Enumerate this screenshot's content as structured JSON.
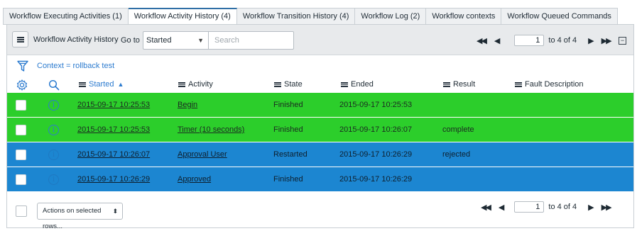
{
  "tabs": [
    {
      "label": "Workflow Executing Activities (1)",
      "active": false
    },
    {
      "label": "Workflow Activity History (4)",
      "active": true
    },
    {
      "label": "Workflow Transition History (4)",
      "active": false
    },
    {
      "label": "Workflow Log (2)",
      "active": false
    },
    {
      "label": "Workflow contexts",
      "active": false
    },
    {
      "label": "Workflow Queued Commands",
      "active": false
    }
  ],
  "toolbar": {
    "list_title": "Workflow Activity History",
    "goto_label": "Go to",
    "goto_value": "Started",
    "search_placeholder": "Search",
    "menu_icon": "hamburger-icon"
  },
  "pagination": {
    "current_page": "1",
    "range_text": "to 4 of 4"
  },
  "filter": {
    "breadcrumb": "Context = rollback test",
    "icon": "funnel-icon"
  },
  "columns": [
    {
      "label": "Started",
      "sorted": "ascending"
    },
    {
      "label": "Activity"
    },
    {
      "label": "State"
    },
    {
      "label": "Ended"
    },
    {
      "label": "Result"
    },
    {
      "label": "Fault Description"
    }
  ],
  "rows": [
    {
      "started": "2015-09-17 10:25:53",
      "activity": "Begin",
      "state": "Finished",
      "ended": "2015-09-17 10:25:53",
      "result": "",
      "fault": "",
      "color": "#2cce2b"
    },
    {
      "started": "2015-09-17 10:25:53",
      "activity": "Timer (10 seconds)",
      "state": "Finished",
      "ended": "2015-09-17 10:26:07",
      "result": "complete",
      "fault": "",
      "color": "#2cce2b"
    },
    {
      "started": "2015-09-17 10:26:07",
      "activity": "Approval User",
      "state": "Restarted",
      "ended": "2015-09-17 10:26:29",
      "result": "rejected",
      "fault": "",
      "color": "#1c86d1"
    },
    {
      "started": "2015-09-17 10:26:29",
      "activity": "Approved",
      "state": "Finished",
      "ended": "2015-09-17 10:26:29",
      "result": "",
      "fault": "",
      "color": "#1c86d1"
    }
  ],
  "footer": {
    "actions_label": "Actions on selected rows..."
  },
  "colors": {
    "accent": "#2c7bcf",
    "row_green": "#2cce2b",
    "row_blue": "#1c86d1"
  }
}
